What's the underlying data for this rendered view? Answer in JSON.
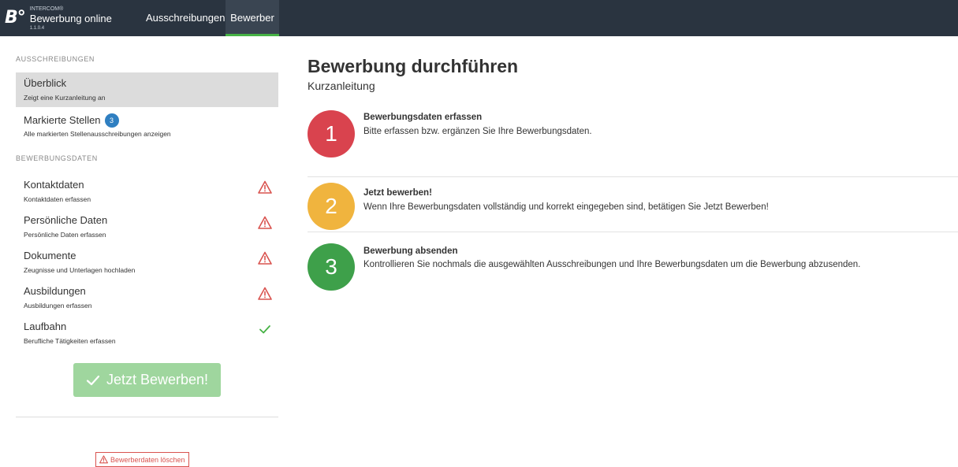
{
  "colors": {
    "navbar": "#2a3440",
    "active_tab_underline": "#46b245",
    "step1": "#d9434e",
    "step2": "#f0b43e",
    "step3": "#3ea04a",
    "badge": "#2f7fc1",
    "warning": "#d9534f",
    "ok": "#46b245",
    "apply_button": "#9fd69e"
  },
  "navbar": {
    "logo_mark": "B°",
    "brand_small": "INTERCOM®",
    "brand_title": "Bewerbung online",
    "version": "1.1.0.4",
    "links": [
      {
        "label": "Ausschreibungen",
        "active": false
      },
      {
        "label": "Bewerber",
        "active": true
      }
    ]
  },
  "sidebar": {
    "section_ausschreibungen": "AUSSCHREIBUNGEN",
    "ueberblick": {
      "title": "Überblick",
      "subtitle": "Zeigt eine Kurzanleitung an"
    },
    "markierte": {
      "title": "Markierte Stellen",
      "badge": "3",
      "subtitle": "Alle markierten Stellenausschreibungen anzeigen"
    },
    "section_bewerbungsdaten": "BEWERBUNGSDATEN",
    "items": [
      {
        "title": "Kontaktdaten",
        "subtitle": "Kontaktdaten erfassen",
        "status_icon": "warning-icon"
      },
      {
        "title": "Persönliche Daten",
        "subtitle": "Persönliche Daten erfassen",
        "status_icon": "warning-icon"
      },
      {
        "title": "Dokumente",
        "subtitle": "Zeugnisse und Unterlagen hochladen",
        "status_icon": "warning-icon"
      },
      {
        "title": "Ausbildungen",
        "subtitle": "Ausbildungen erfassen",
        "status_icon": "warning-icon"
      },
      {
        "title": "Laufbahn",
        "subtitle": "Berufliche Tätigkeiten erfassen",
        "status_icon": "check-icon"
      }
    ],
    "apply_button": "Jetzt Bewerben!",
    "delete_button": "Bewerberdaten löschen"
  },
  "main": {
    "title": "Bewerbung durchführen",
    "subtitle": "Kurzanleitung",
    "steps": [
      {
        "number": "1",
        "heading": "Bewerbungsdaten erfassen",
        "text": "Bitte erfassen bzw. ergänzen Sie Ihre Bewerbungsdaten."
      },
      {
        "number": "2",
        "heading": "Jetzt bewerben!",
        "text": "Wenn Ihre Bewerbungsdaten vollständig und korrekt eingegeben sind, betätigen Sie Jetzt Bewerben!"
      },
      {
        "number": "3",
        "heading": "Bewerbung absenden",
        "text": "Kontrollieren Sie nochmals die ausgewählten Ausschreibungen und Ihre Bewerbungsdaten um die Bewerbung abzusenden."
      }
    ]
  }
}
